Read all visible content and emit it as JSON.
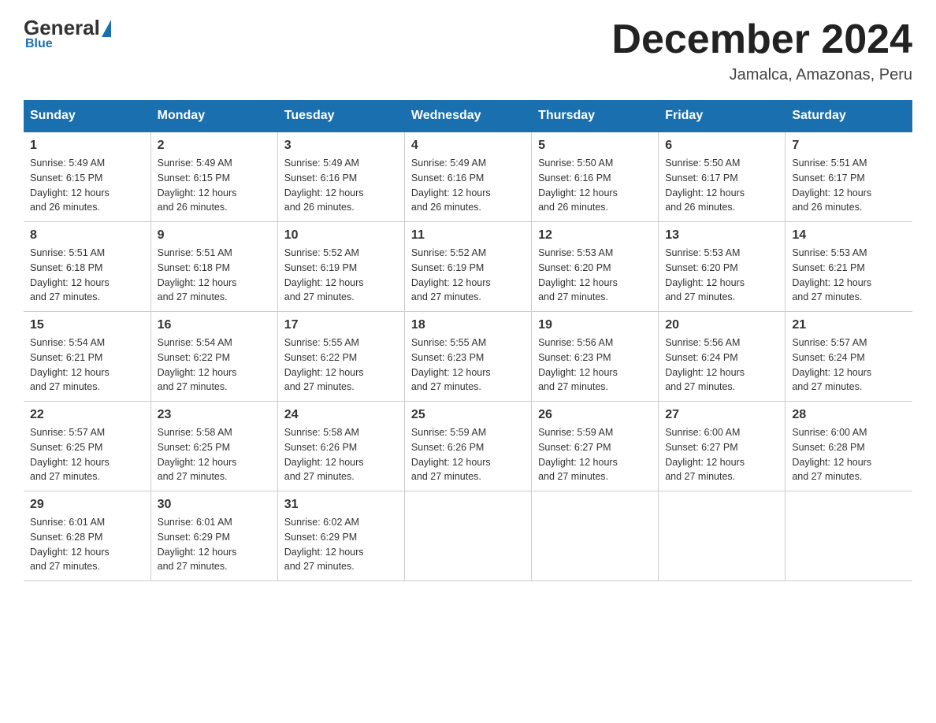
{
  "header": {
    "logo_general": "General",
    "logo_blue": "Blue",
    "month_title": "December 2024",
    "location": "Jamalca, Amazonas, Peru"
  },
  "weekdays": [
    "Sunday",
    "Monday",
    "Tuesday",
    "Wednesday",
    "Thursday",
    "Friday",
    "Saturday"
  ],
  "weeks": [
    [
      {
        "day": "1",
        "sunrise": "5:49 AM",
        "sunset": "6:15 PM",
        "daylight": "12 hours and 26 minutes."
      },
      {
        "day": "2",
        "sunrise": "5:49 AM",
        "sunset": "6:15 PM",
        "daylight": "12 hours and 26 minutes."
      },
      {
        "day": "3",
        "sunrise": "5:49 AM",
        "sunset": "6:16 PM",
        "daylight": "12 hours and 26 minutes."
      },
      {
        "day": "4",
        "sunrise": "5:49 AM",
        "sunset": "6:16 PM",
        "daylight": "12 hours and 26 minutes."
      },
      {
        "day": "5",
        "sunrise": "5:50 AM",
        "sunset": "6:16 PM",
        "daylight": "12 hours and 26 minutes."
      },
      {
        "day": "6",
        "sunrise": "5:50 AM",
        "sunset": "6:17 PM",
        "daylight": "12 hours and 26 minutes."
      },
      {
        "day": "7",
        "sunrise": "5:51 AM",
        "sunset": "6:17 PM",
        "daylight": "12 hours and 26 minutes."
      }
    ],
    [
      {
        "day": "8",
        "sunrise": "5:51 AM",
        "sunset": "6:18 PM",
        "daylight": "12 hours and 27 minutes."
      },
      {
        "day": "9",
        "sunrise": "5:51 AM",
        "sunset": "6:18 PM",
        "daylight": "12 hours and 27 minutes."
      },
      {
        "day": "10",
        "sunrise": "5:52 AM",
        "sunset": "6:19 PM",
        "daylight": "12 hours and 27 minutes."
      },
      {
        "day": "11",
        "sunrise": "5:52 AM",
        "sunset": "6:19 PM",
        "daylight": "12 hours and 27 minutes."
      },
      {
        "day": "12",
        "sunrise": "5:53 AM",
        "sunset": "6:20 PM",
        "daylight": "12 hours and 27 minutes."
      },
      {
        "day": "13",
        "sunrise": "5:53 AM",
        "sunset": "6:20 PM",
        "daylight": "12 hours and 27 minutes."
      },
      {
        "day": "14",
        "sunrise": "5:53 AM",
        "sunset": "6:21 PM",
        "daylight": "12 hours and 27 minutes."
      }
    ],
    [
      {
        "day": "15",
        "sunrise": "5:54 AM",
        "sunset": "6:21 PM",
        "daylight": "12 hours and 27 minutes."
      },
      {
        "day": "16",
        "sunrise": "5:54 AM",
        "sunset": "6:22 PM",
        "daylight": "12 hours and 27 minutes."
      },
      {
        "day": "17",
        "sunrise": "5:55 AM",
        "sunset": "6:22 PM",
        "daylight": "12 hours and 27 minutes."
      },
      {
        "day": "18",
        "sunrise": "5:55 AM",
        "sunset": "6:23 PM",
        "daylight": "12 hours and 27 minutes."
      },
      {
        "day": "19",
        "sunrise": "5:56 AM",
        "sunset": "6:23 PM",
        "daylight": "12 hours and 27 minutes."
      },
      {
        "day": "20",
        "sunrise": "5:56 AM",
        "sunset": "6:24 PM",
        "daylight": "12 hours and 27 minutes."
      },
      {
        "day": "21",
        "sunrise": "5:57 AM",
        "sunset": "6:24 PM",
        "daylight": "12 hours and 27 minutes."
      }
    ],
    [
      {
        "day": "22",
        "sunrise": "5:57 AM",
        "sunset": "6:25 PM",
        "daylight": "12 hours and 27 minutes."
      },
      {
        "day": "23",
        "sunrise": "5:58 AM",
        "sunset": "6:25 PM",
        "daylight": "12 hours and 27 minutes."
      },
      {
        "day": "24",
        "sunrise": "5:58 AM",
        "sunset": "6:26 PM",
        "daylight": "12 hours and 27 minutes."
      },
      {
        "day": "25",
        "sunrise": "5:59 AM",
        "sunset": "6:26 PM",
        "daylight": "12 hours and 27 minutes."
      },
      {
        "day": "26",
        "sunrise": "5:59 AM",
        "sunset": "6:27 PM",
        "daylight": "12 hours and 27 minutes."
      },
      {
        "day": "27",
        "sunrise": "6:00 AM",
        "sunset": "6:27 PM",
        "daylight": "12 hours and 27 minutes."
      },
      {
        "day": "28",
        "sunrise": "6:00 AM",
        "sunset": "6:28 PM",
        "daylight": "12 hours and 27 minutes."
      }
    ],
    [
      {
        "day": "29",
        "sunrise": "6:01 AM",
        "sunset": "6:28 PM",
        "daylight": "12 hours and 27 minutes."
      },
      {
        "day": "30",
        "sunrise": "6:01 AM",
        "sunset": "6:29 PM",
        "daylight": "12 hours and 27 minutes."
      },
      {
        "day": "31",
        "sunrise": "6:02 AM",
        "sunset": "6:29 PM",
        "daylight": "12 hours and 27 minutes."
      },
      null,
      null,
      null,
      null
    ]
  ],
  "labels": {
    "sunrise": "Sunrise:",
    "sunset": "Sunset:",
    "daylight": "Daylight:"
  }
}
